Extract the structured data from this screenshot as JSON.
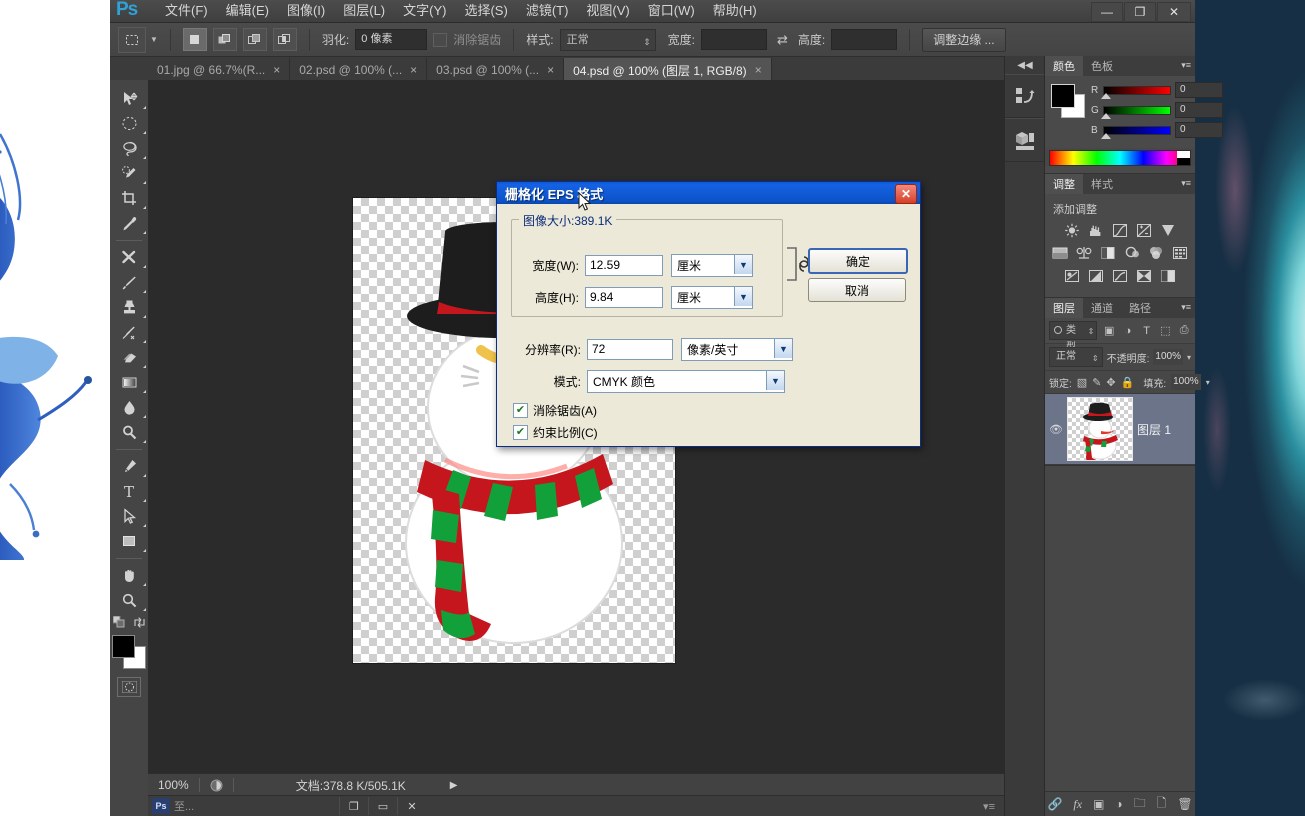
{
  "app": {
    "logo": "Ps",
    "menus": [
      {
        "label": "文件(F)"
      },
      {
        "label": "编辑(E)"
      },
      {
        "label": "图像(I)"
      },
      {
        "label": "图层(L)"
      },
      {
        "label": "文字(Y)"
      },
      {
        "label": "选择(S)"
      },
      {
        "label": "滤镜(T)"
      },
      {
        "label": "视图(V)"
      },
      {
        "label": "窗口(W)"
      },
      {
        "label": "帮助(H)"
      }
    ],
    "window_controls": {
      "minimize": "—",
      "maximize": "❐",
      "close": "✕"
    }
  },
  "options_bar": {
    "tool_icon": "rectangular-marquee-icon",
    "selection_modes": [
      "new-selection",
      "add-to-selection",
      "subtract-from-selection",
      "intersect-selection"
    ],
    "feather_label": "羽化:",
    "feather_value": "0 像素",
    "antialias_label": "消除锯齿",
    "antialias_checked": false,
    "style_label": "样式:",
    "style_value": "正常",
    "width_label": "宽度:",
    "width_value": "",
    "swap_icon": "swap-arrows-icon",
    "height_label": "高度:",
    "height_value": "",
    "refine_edge_label": "调整边缘 ..."
  },
  "tabs": [
    {
      "label": "01.jpg @ 66.7%(R...",
      "active": false,
      "close": "×"
    },
    {
      "label": "02.psd @ 100% (...",
      "active": false,
      "close": "×"
    },
    {
      "label": "03.psd @ 100% (...",
      "active": false,
      "close": "×"
    },
    {
      "label": "04.psd @ 100% (图层 1, RGB/8)",
      "active": true,
      "close": "×"
    }
  ],
  "toolbox": {
    "tools": [
      {
        "name": "move-tool"
      },
      {
        "name": "elliptical-marquee-tool"
      },
      {
        "name": "lasso-tool"
      },
      {
        "name": "quick-selection-tool"
      },
      {
        "name": "crop-tool"
      },
      {
        "name": "eyedropper-tool"
      },
      {
        "name": "healing-brush-tool"
      },
      {
        "name": "brush-tool"
      },
      {
        "name": "clone-stamp-tool"
      },
      {
        "name": "history-brush-tool"
      },
      {
        "name": "eraser-tool"
      },
      {
        "name": "gradient-tool"
      },
      {
        "name": "blur-tool"
      },
      {
        "name": "dodge-tool"
      },
      {
        "name": "pen-tool"
      },
      {
        "name": "horizontal-type-tool"
      },
      {
        "name": "path-selection-tool"
      },
      {
        "name": "rectangle-tool"
      },
      {
        "name": "hand-tool"
      },
      {
        "name": "zoom-tool"
      }
    ],
    "foreground_color": "#000000",
    "background_color": "#ffffff",
    "quick_mask": "quick-mask-icon"
  },
  "status_bar": {
    "zoom": "100%",
    "doc_label": "文档:378.8 K/505.1K",
    "arrow": "▶"
  },
  "doc_window_bar": {
    "logo": "Ps",
    "title": "至...",
    "buttons": [
      "❐",
      "▭",
      "✕"
    ]
  },
  "dock_rail": {
    "collapse": "◀◀",
    "buttons": [
      {
        "name": "mini-bridge-icon"
      },
      {
        "name": "3d-panel-icon"
      }
    ]
  },
  "panels": {
    "color": {
      "tabs": [
        {
          "label": "颜色",
          "active": true
        },
        {
          "label": "色板",
          "active": false
        }
      ],
      "menu": "▾≡",
      "channels": [
        {
          "label": "R",
          "value": "0",
          "from": "#000000",
          "to": "#ff0000"
        },
        {
          "label": "G",
          "value": "0",
          "from": "#000000",
          "to": "#00ff00"
        },
        {
          "label": "B",
          "value": "0",
          "from": "#000000",
          "to": "#0000ff"
        }
      ]
    },
    "adjustments": {
      "tabs": [
        {
          "label": "调整",
          "active": true
        },
        {
          "label": "样式",
          "active": false
        }
      ],
      "menu": "▾≡",
      "heading": "添加调整",
      "rows": [
        [
          "brightness-contrast-icon",
          "levels-icon",
          "curves-icon",
          "exposure-icon",
          "vibrance-icon"
        ],
        [
          "hue-saturation-icon",
          "color-balance-icon",
          "black-white-icon",
          "photo-filter-icon",
          "channel-mixer-icon",
          "posterize-icon"
        ],
        [
          "invert-icon",
          "threshold-icon",
          "gradient-map-icon",
          "selective-color-icon",
          "color-lookup-icon"
        ]
      ]
    },
    "layers": {
      "tabs": [
        {
          "label": "图层",
          "active": true
        },
        {
          "label": "通道",
          "active": false
        },
        {
          "label": "路径",
          "active": false
        }
      ],
      "menu": "▾≡",
      "filter_value": "类型",
      "filter_icons": [
        "pixel-filter-icon",
        "adjustment-filter-icon",
        "type-filter-icon",
        "shape-filter-icon",
        "smart-object-filter-icon"
      ],
      "blend_mode": "正常",
      "opacity_label": "不透明度:",
      "opacity_value": "100%",
      "lock_label": "锁定:",
      "lock_icons": [
        "lock-transparent-icon",
        "lock-image-icon",
        "lock-position-icon",
        "lock-all-icon"
      ],
      "fill_label": "填充:",
      "fill_value": "100%",
      "items": [
        {
          "name": "图层 1",
          "visible": true,
          "thumb": "snowman-thumb"
        }
      ],
      "footer_icons": [
        "link-layers-icon",
        "layer-style-icon",
        "layer-mask-icon",
        "adjustment-layer-icon",
        "new-group-icon",
        "new-layer-icon",
        "delete-layer-icon"
      ]
    }
  },
  "dialog": {
    "title": "栅格化 EPS 格式",
    "close": "✕",
    "group_title": "图像大小:389.1K",
    "fields": [
      {
        "label": "宽度(W):",
        "value": "12.59",
        "unit": "厘米"
      },
      {
        "label": "高度(H):",
        "value": "9.84",
        "unit": "厘米"
      }
    ],
    "resolution": {
      "label": "分辨率(R):",
      "value": "72",
      "unit": "像素/英寸"
    },
    "mode": {
      "label": "模式:",
      "value": "CMYK 颜色"
    },
    "checkboxes": [
      {
        "label": "消除锯齿(A)",
        "checked": true
      },
      {
        "label": "约束比例(C)",
        "checked": true
      }
    ],
    "buttons": [
      {
        "label": "确定",
        "default": true
      },
      {
        "label": "取消",
        "default": false
      }
    ],
    "chain_icon": "link-constrain-icon"
  }
}
